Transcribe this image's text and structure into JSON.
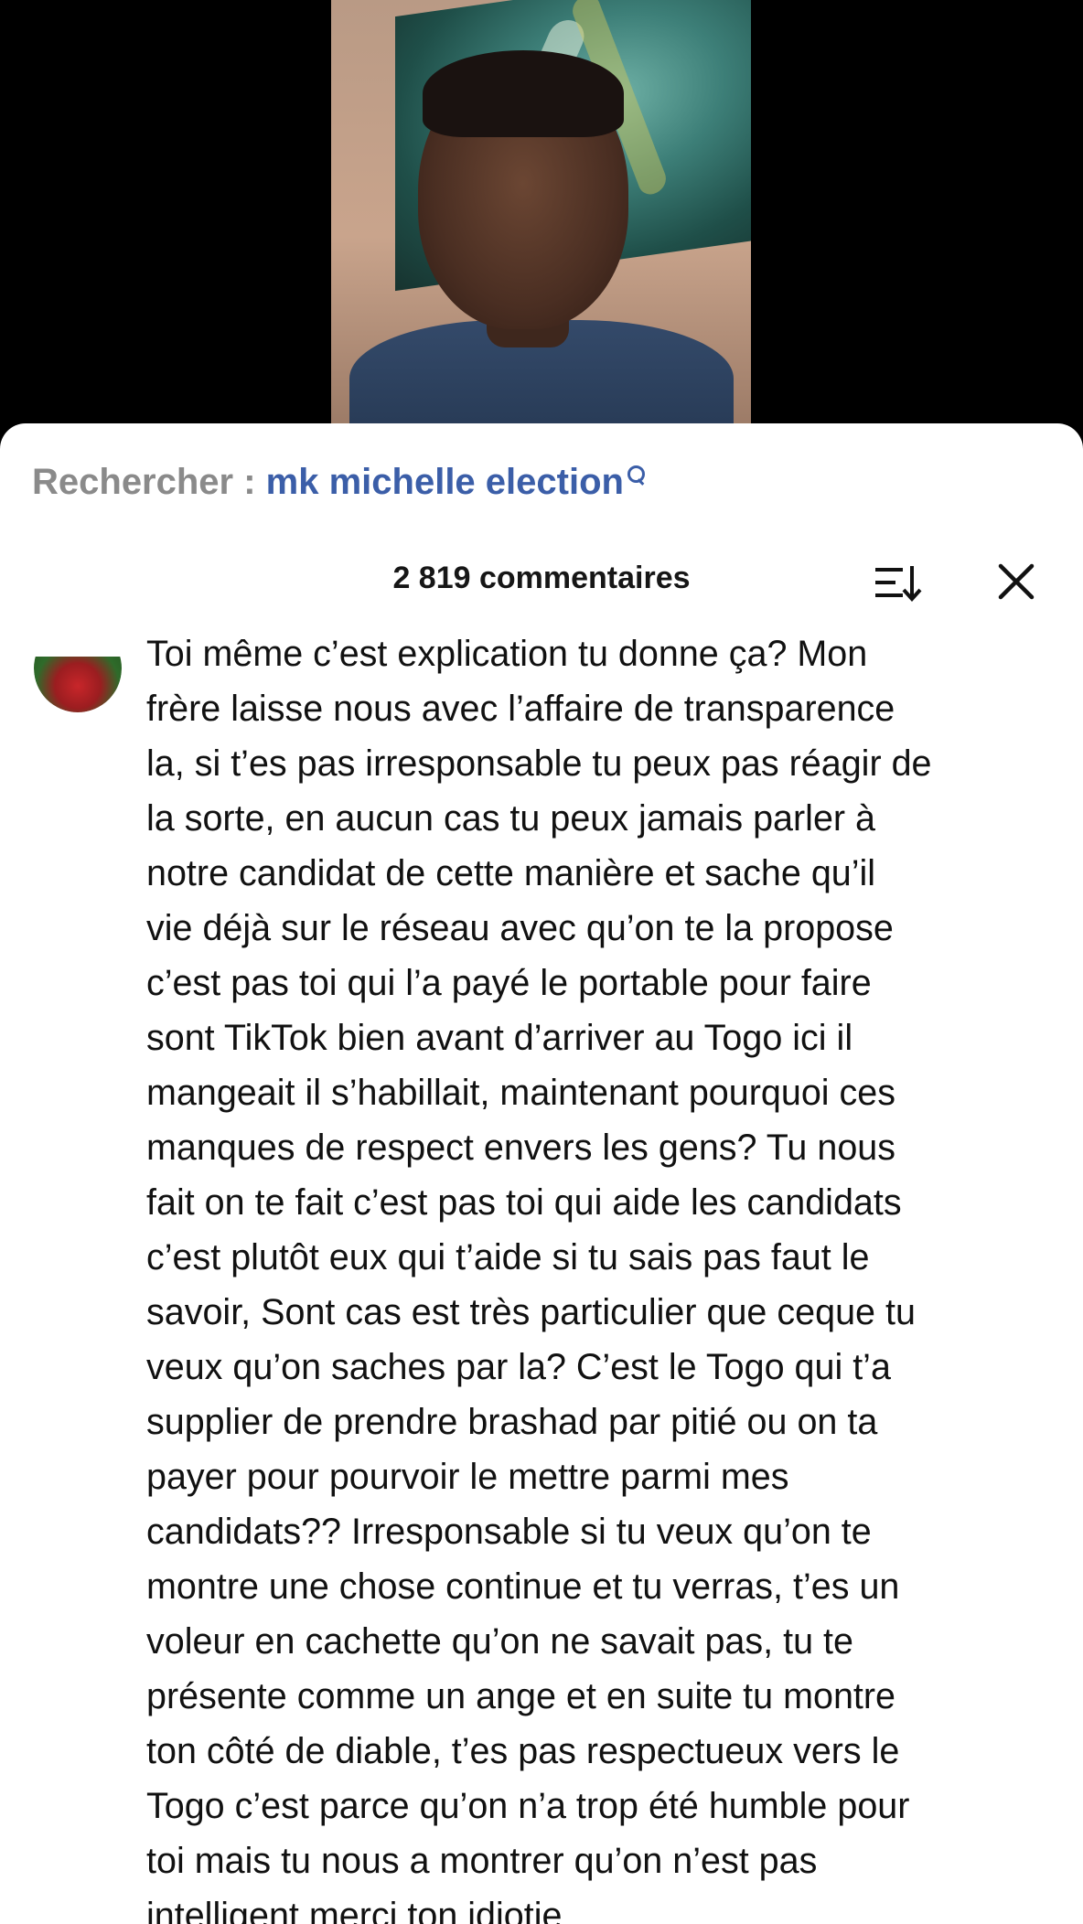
{
  "search": {
    "prefix": "Rechercher : ",
    "query": "mk michelle election"
  },
  "comments_header": {
    "count_label": "2 819 commentaires"
  },
  "comment": {
    "text": "Toi même c’est explication tu donne ça? Mon\nfrère laisse nous avec l’affaire de transparence\nla, si t’es pas irresponsable tu peux pas réagir de\nla sorte, en aucun cas tu peux jamais parler à\nnotre candidat de cette manière et sache qu’il\nvie déjà sur le réseau avec qu’on te la propose\nc’est pas toi qui l’a payé le portable pour faire\nsont TikTok bien avant d’arriver au Togo ici il\nmangeait il s’habillait, maintenant pourquoi ces\nmanques de respect envers les gens? Tu nous\nfait on te fait c’est pas toi qui aide les candidats\nc’est plutôt eux qui t’aide si tu sais pas faut le\nsavoir, Sont cas est très particulier que ceque tu\nveux qu’on saches par la? C’est le Togo qui t’a\nsupplier de prendre brashad par pitié ou on ta\npayer pour pourvoir le mettre parmi mes\ncandidats?? Irresponsable si tu veux qu’on te\nmontre une chose continue et tu verras, t’es un\nvoleur en cachette qu’on ne savait pas, tu te\nprésente comme un ange et en suite tu montre\nton côté de diable, t’es pas respectueux vers le\nTogo c’est parce qu’on n’a trop été humble pour\ntoi mais tu nous a montrer qu’on n’est pas\nintelligent merci ton idiotie"
  },
  "icons": {
    "search": "search-icon",
    "sort": "sort-icon",
    "close": "close-icon"
  },
  "colors": {
    "query_link": "#3b5ea8",
    "prefix_gray": "#8a8a8a",
    "sheet_bg": "#ffffff",
    "video_bg": "#000000"
  }
}
